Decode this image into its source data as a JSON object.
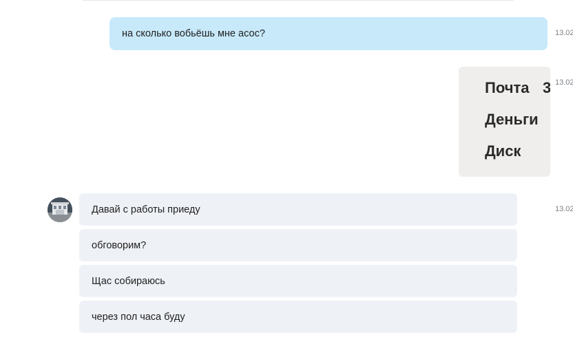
{
  "messages": {
    "out_1": {
      "text": "на сколько вобьёшь мне асос?",
      "time": "13.02"
    },
    "out_image": {
      "time": "13.02",
      "lines": [
        "Почта",
        "Деньги",
        "Диск"
      ],
      "digit": "3"
    },
    "in_group": {
      "time": "13.02",
      "items": [
        "Давай с работы приеду",
        "обговорим?",
        "Щас собираюсь",
        "через пол часа буду"
      ]
    }
  },
  "colors": {
    "outgoing_bubble": "#c7e9fa",
    "incoming_bubble": "#eef1f6",
    "timestamp": "#7a7f85"
  },
  "icons": {
    "avatar": "contact-avatar",
    "read": "read-receipt-icon"
  }
}
